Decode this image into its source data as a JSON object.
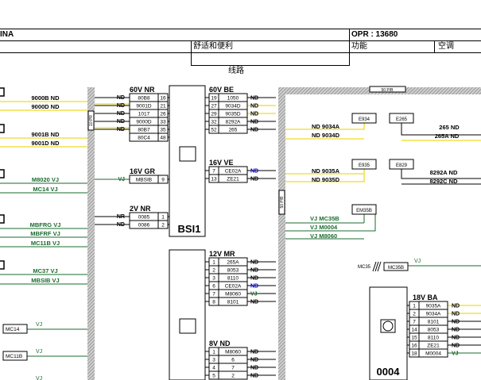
{
  "header": {
    "title_fragment": "INA",
    "opr": "OPR : 13680",
    "category_cn": "舒适和便利",
    "function_label": "功能",
    "function_value": "空调",
    "section_cn": "线路"
  },
  "left_wires": [
    "9000B ND",
    "9000D ND",
    "9001B ND",
    "9001D ND",
    "M8020 VJ",
    "MC14 VJ",
    "MBFRG VJ",
    "MBFRF VJ",
    "MC11B VJ",
    "MC37 VJ",
    "MBSIB VJ"
  ],
  "left_parts": [
    "MC14",
    "MC11B"
  ],
  "left_small": [
    "VJ",
    "VJ",
    "VJ"
  ],
  "colors": {
    "nd": "#000000",
    "vj": "#1a6b2e",
    "yellow": "#f0e24a",
    "blue": "#0000cc"
  },
  "bsi": {
    "label": "BSI1",
    "side_code": "10 PR"
  },
  "c60nr": {
    "title": "60V NR",
    "rows": [
      [
        "ND",
        "80B8",
        "16"
      ],
      [
        "ND",
        "9001D",
        "21"
      ],
      [
        "ND",
        "1017",
        "26"
      ],
      [
        "ND",
        "9000D",
        "33"
      ],
      [
        "ND",
        "80B7",
        "35"
      ],
      [
        "",
        "80C4",
        "48"
      ]
    ]
  },
  "c16gr": {
    "title": "16V GR",
    "rows": [
      [
        "VJ",
        "MBSIB",
        "9"
      ]
    ]
  },
  "c2nr": {
    "title": "2V NR",
    "rows": [
      [
        "NR",
        "0085",
        "1"
      ],
      [
        "ND",
        "0086",
        "2"
      ]
    ]
  },
  "c60be": {
    "title": "60V BE",
    "rows": [
      [
        "19",
        "1050",
        "ND"
      ],
      [
        "27",
        "9034D",
        "ND"
      ],
      [
        "29",
        "9035D",
        "ND"
      ],
      [
        "32",
        "8292A",
        "ND"
      ],
      [
        "52",
        "265",
        "ND"
      ]
    ]
  },
  "c16ve": {
    "title": "16V VE",
    "rows": [
      [
        "7",
        "CE02A",
        "ND"
      ],
      [
        "13",
        "ZE21",
        "ND"
      ]
    ]
  },
  "c12mr": {
    "title": "12V MR",
    "rows": [
      [
        "1",
        "265A",
        "ND"
      ],
      [
        "2",
        "8053",
        "ND"
      ],
      [
        "3",
        "8110",
        "ND"
      ],
      [
        "6",
        "CE02A",
        "ND"
      ],
      [
        "7",
        "M8060",
        "VJ"
      ],
      [
        "8",
        "8101",
        "ND"
      ]
    ]
  },
  "c8nd": {
    "title": "8V ND",
    "rows": [
      [
        "1",
        "M8060",
        "ND"
      ],
      [
        "3",
        "6",
        "ND"
      ],
      [
        "4",
        "7",
        "ND"
      ],
      [
        "5",
        "2",
        "ND"
      ]
    ]
  },
  "c18ba": {
    "title": "18V BA",
    "rows": [
      [
        "1",
        "9035A",
        "ND"
      ],
      [
        "2",
        "9034A",
        "ND"
      ],
      [
        "7",
        "8101",
        "ND"
      ],
      [
        "14",
        "8053",
        "ND"
      ],
      [
        "15",
        "8110",
        "ND"
      ],
      [
        "16",
        "ZE21",
        "ND"
      ],
      [
        "18",
        "M0004",
        "VJ"
      ]
    ]
  },
  "right": {
    "bus_label": "50 P/B",
    "vbus_label": "50 P/B",
    "components": [
      "E934",
      "E265",
      "E935",
      "E829",
      "EM35B"
    ],
    "wires_e934": [
      "ND 9034A",
      "ND 9034D"
    ],
    "wires_e265": [
      "265 ND",
      "265A ND"
    ],
    "wires_e935": [
      "ND 9035A",
      "ND 9035D"
    ],
    "wires_e829": [
      "8292A ND",
      "8292C ND"
    ],
    "wires_em35b": [
      "VJ MC35B",
      "VJ M0004",
      "VJ M8060"
    ],
    "mc35_left": "MC35",
    "mc35_box": "MC35B",
    "mc35_vj": "VJ",
    "module_label": "0004"
  }
}
